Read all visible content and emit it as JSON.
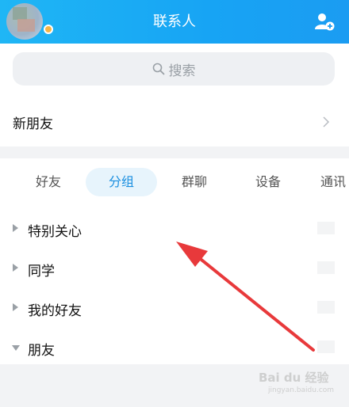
{
  "header": {
    "title": "联系人",
    "accent": "#1fb6f5"
  },
  "search": {
    "placeholder": "搜索"
  },
  "new_friends": {
    "label": "新朋友"
  },
  "tabs": [
    {
      "label": "好友",
      "active": false
    },
    {
      "label": "分组",
      "active": true
    },
    {
      "label": "群聊",
      "active": false
    },
    {
      "label": "设备",
      "active": false
    },
    {
      "label": "通讯",
      "active": false
    }
  ],
  "groups": [
    {
      "label": "特别关心",
      "expanded": false
    },
    {
      "label": "同学",
      "expanded": false
    },
    {
      "label": "我的好友",
      "expanded": false
    },
    {
      "label": "朋友",
      "expanded": true
    }
  ],
  "watermark": {
    "main": "Bai du 经验",
    "sub": "jingyan.baidu.com"
  },
  "icons": [
    "avatar",
    "add-friend-icon",
    "search-icon",
    "chevron-right-icon",
    "triangle-right-icon",
    "triangle-down-icon",
    "annotation-arrow"
  ]
}
